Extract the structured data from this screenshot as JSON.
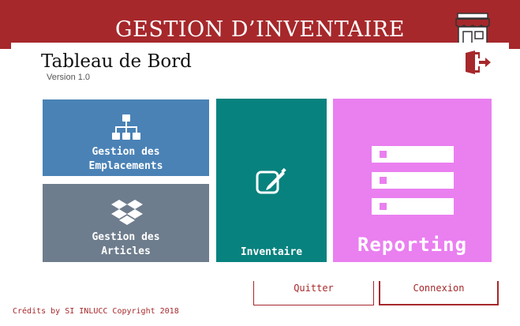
{
  "app": {
    "title": "GESTION D’INVENTAIRE",
    "brand_color": "#a6282b"
  },
  "header": {
    "dashboard_title": "Tableau de Bord",
    "version": "Version 1.0",
    "store_icon": "store-icon",
    "exit_icon": "exit-door-icon"
  },
  "tiles": {
    "emplacements": {
      "line1": "Gestion des",
      "line2": "Emplacements",
      "icon": "sitemap-icon",
      "color": "#4a82b6"
    },
    "articles": {
      "line1": "Gestion des",
      "line2": "Articles",
      "icon": "dropbox-icon",
      "color": "#6e7d8d"
    },
    "inventaire": {
      "label": "Inventaire",
      "icon": "edit-icon",
      "color": "#08827e"
    },
    "reporting": {
      "label": "Reporting",
      "icon": "list-icon",
      "color": "#ea7ff0"
    }
  },
  "buttons": {
    "quit": "Quitter",
    "connect": "Connexion"
  },
  "footer": {
    "credits": "Crédits by SI INLUCC Copyright 2018"
  }
}
